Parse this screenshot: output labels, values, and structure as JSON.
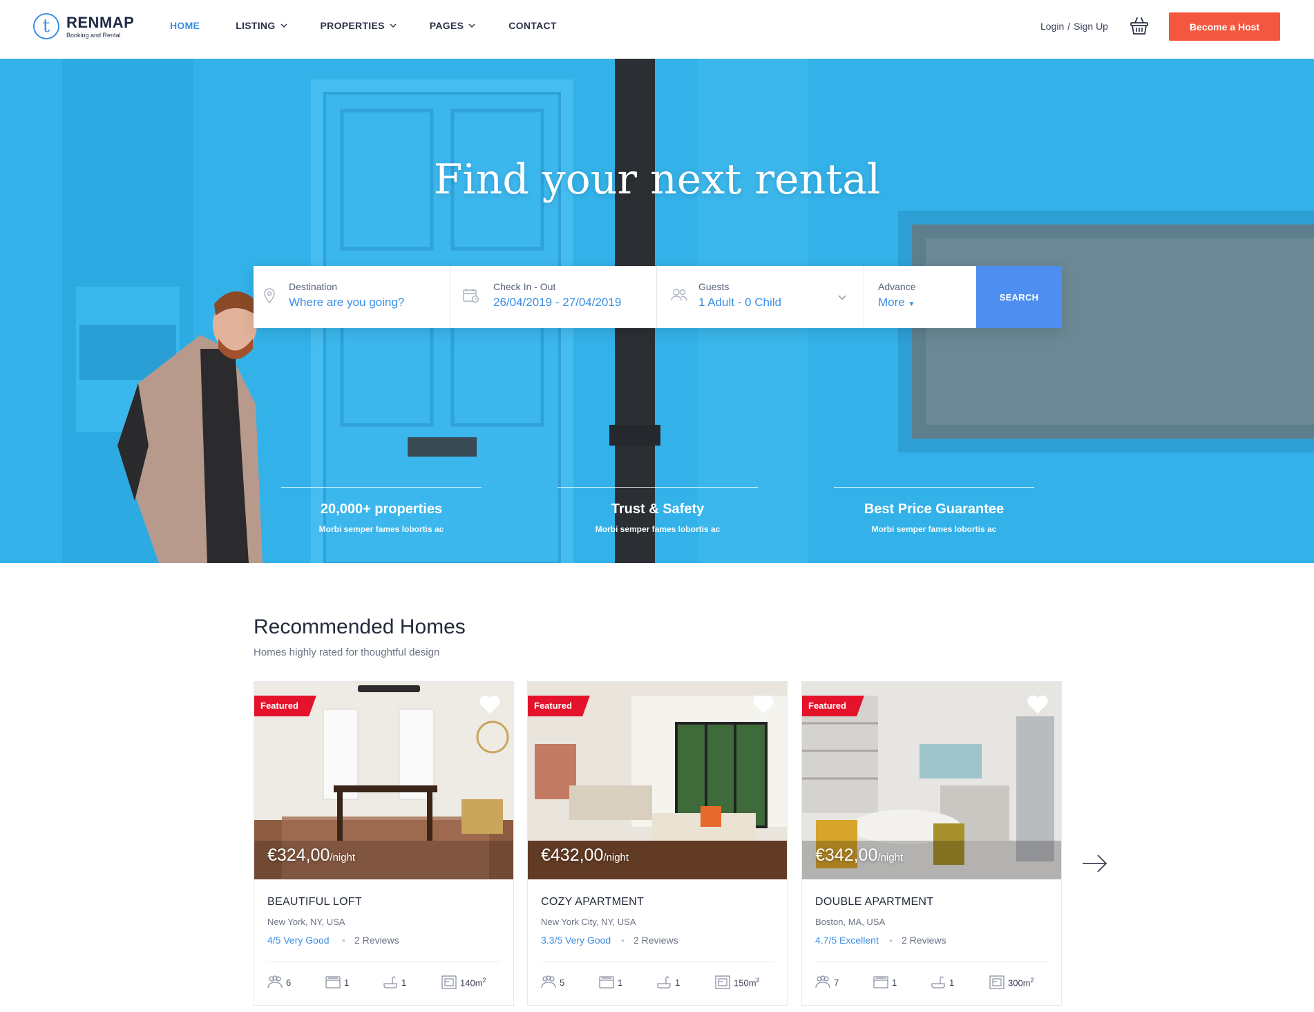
{
  "header": {
    "logo_name": "RENMAP",
    "logo_tagline": "Booking and Rental",
    "nav": [
      {
        "label": "HOME",
        "active": true
      },
      {
        "label": "LISTING",
        "dropdown": true
      },
      {
        "label": "PROPERTIES",
        "dropdown": true
      },
      {
        "label": "PAGES",
        "dropdown": true
      },
      {
        "label": "CONTACT"
      }
    ],
    "login": "Login",
    "separator": "/",
    "signup": "Sign Up",
    "cta": "Become a Host"
  },
  "hero": {
    "title": "Find your next rental",
    "search": {
      "destination_label": "Destination",
      "destination_value": "Where are you going?",
      "date_label": "Check In - Out",
      "date_value": "26/04/2019 - 27/04/2019",
      "guests_label": "Guests",
      "guests_value": "1 Adult - 0 Child",
      "advance_label": "Advance",
      "advance_value": "More",
      "button": "SEARCH"
    },
    "features": [
      {
        "title": "20,000+ properties",
        "desc": "Morbi semper fames lobortis ac"
      },
      {
        "title": "Trust & Safety",
        "desc": "Morbi semper fames lobortis ac"
      },
      {
        "title": "Best Price Guarantee",
        "desc": "Morbi semper fames lobortis ac"
      }
    ]
  },
  "recommended": {
    "title": "Recommended Homes",
    "subtitle": "Homes highly rated for thoughtful design",
    "cards": [
      {
        "badge": "Featured",
        "price": "€324,00",
        "per": "/night",
        "name": "BEAUTIFUL LOFT",
        "location": "New York, NY, USA",
        "rating": "4/5 Very Good",
        "dot": "•",
        "reviews": "2 Reviews",
        "guests": "6",
        "beds": "1",
        "baths": "1",
        "area": "140m",
        "area_unit": "2"
      },
      {
        "badge": "Featured",
        "price": "€432,00",
        "per": "/night",
        "name": "COZY APARTMENT",
        "location": "New York City, NY, USA",
        "rating": "3.3/5 Very Good",
        "dot": "•",
        "reviews": "2 Reviews",
        "guests": "5",
        "beds": "1",
        "baths": "1",
        "area": "150m",
        "area_unit": "2"
      },
      {
        "badge": "Featured",
        "price": "€342,00",
        "per": "/night",
        "name": "DOUBLE APARTMENT",
        "location": "Boston, MA, USA",
        "rating": "4.7/5 Excellent",
        "dot": "•",
        "reviews": "2 Reviews",
        "guests": "7",
        "beds": "1",
        "baths": "1",
        "area": "300m",
        "area_unit": "2"
      }
    ]
  },
  "colors": {
    "accent": "#3a8ee6",
    "cta": "#f4573f",
    "badge": "#e4132b",
    "search_button": "#4d8ef0",
    "hero_blue": "#2fb0e8"
  },
  "icons": [
    "location-pin-icon",
    "calendar-icon",
    "guests-icon",
    "chevron-down-icon",
    "basket-icon",
    "heart-icon",
    "bed-icon",
    "bath-icon",
    "area-icon",
    "arrow-right-icon"
  ]
}
